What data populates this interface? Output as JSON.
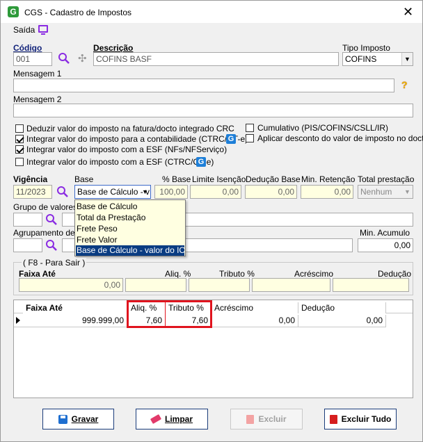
{
  "window": {
    "title": "CGS - Cadastro de Impostos"
  },
  "menu": {
    "exit_label": "Saída"
  },
  "form": {
    "codigo_label": "Código",
    "codigo_value": "001",
    "descricao_label": "Descrição",
    "descricao_value": "COFINS BASF",
    "tipo_imposto_label": "Tipo Imposto",
    "tipo_imposto_value": "COFINS",
    "mensagem1_label": "Mensagem 1",
    "mensagem1_value": "",
    "mensagem2_label": "Mensagem 2",
    "mensagem2_value": ""
  },
  "checkboxes": {
    "deduzir": {
      "label": "Deduzir valor do imposto na fatura/docto integrado CRC",
      "checked": false
    },
    "integrar_contab": {
      "label": "Integrar valor do imposto para a contabilidade (CTRC/CT-e)",
      "checked": true
    },
    "integrar_esf_nfs": {
      "label": "Integrar valor do imposto com a ESF (NFs/NFServiço)",
      "checked": true
    },
    "integrar_esf_ctrc": {
      "label": "Integrar valor do imposto com a ESF (CTRC/CT-e)",
      "checked": false
    },
    "cumulativo": {
      "label": "Cumulativo (PIS/COFINS/CSLL/IR)",
      "checked": false
    },
    "aplicar_desconto": {
      "label": "Aplicar desconto do valor de imposto no docto",
      "checked": false
    }
  },
  "vigencia": {
    "vigencia_label": "Vigência",
    "vigencia_value": "11/2023",
    "base_label": "Base",
    "base_value": "Base de Cálculo - v",
    "pct_base_label": "% Base",
    "pct_base_value": "100,00",
    "limite_isencao_label": "Limite Isenção",
    "limite_isencao_value": "0,00",
    "deducao_base_label": "Dedução Base",
    "deducao_base_value": "0,00",
    "min_retencao_label": "Min. Retenção",
    "min_retencao_value": "0,00",
    "total_prestacao_label": "Total prestação",
    "total_prestacao_value": "Nenhum"
  },
  "dropdown_options": [
    "Base de Cálculo",
    "Total da Prestação",
    "Frete Peso",
    "Frete Valor",
    "Base de Cálculo - valor do ICMS"
  ],
  "grupo_label": "Grupo de valores d",
  "agrupamento_label": "Agrupamento de v",
  "min_acumulo_label": "Min. Acumulo",
  "min_acumulo_value": "0,00",
  "faixa_group": {
    "legend": "( F8 - Para Sair )",
    "faixa_ate_label": "Faixa Até",
    "faixa_ate_value": "0,00",
    "aliq_label": "Aliq. %",
    "tributo_label": "Tributo %",
    "acrescimo_label": "Acréscimo",
    "deducao_label": "Dedução"
  },
  "grid": {
    "headers": [
      "Faixa Até",
      "Aliq. %",
      "Tributo %",
      "Acréscimo",
      "Dedução"
    ],
    "row": [
      "999.999,00",
      "7,60",
      "7,60",
      "0,00",
      "0,00"
    ]
  },
  "buttons": {
    "gravar": "Gravar",
    "limpar": "Limpar",
    "excluir": "Excluir",
    "excluir_tudo": "Excluir Tudo"
  },
  "colors": {
    "highlight_red": "#e0141e",
    "field_yellow": "#ffffe1",
    "selection_blue": "#0a3c82",
    "accent_purple": "#8a2be2"
  }
}
